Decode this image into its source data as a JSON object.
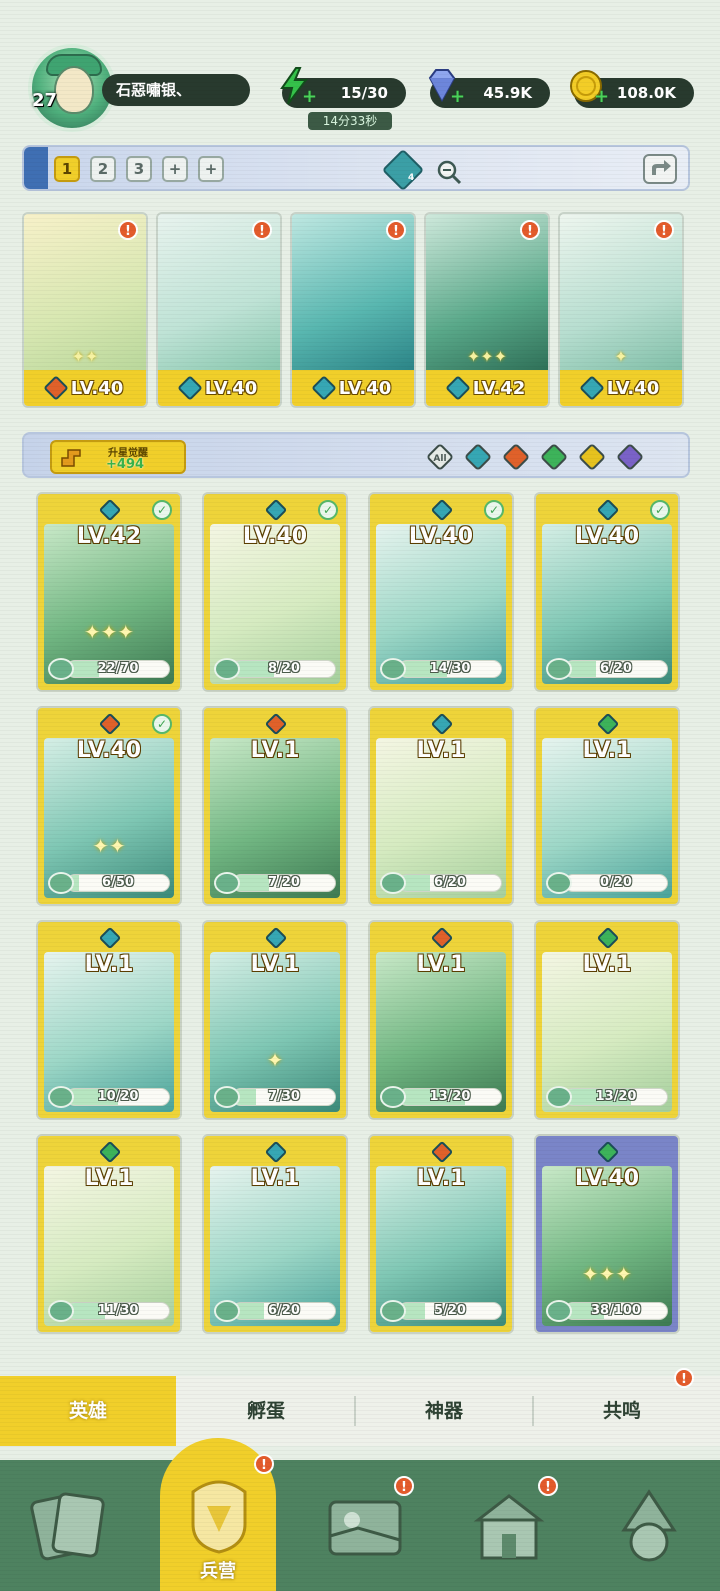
{
  "player": {
    "level": "27",
    "name": "石惡嘯银、"
  },
  "resources": {
    "energy": "15/30",
    "energy_timer": "14分33秒",
    "gems": "45.9K",
    "gold": "108.0K"
  },
  "team": {
    "tabs": [
      "1",
      "2",
      "3",
      "+",
      "+"
    ],
    "active_tab": 0,
    "gem_count": "4"
  },
  "formation": [
    {
      "level": "LV.40",
      "element": "fire",
      "stars": 2,
      "alert": "!"
    },
    {
      "level": "LV.40",
      "element": "water",
      "stars": 0,
      "alert": "!"
    },
    {
      "level": "LV.40",
      "element": "water",
      "stars": 0,
      "alert": "!"
    },
    {
      "level": "LV.42",
      "element": "water",
      "stars": 3,
      "alert": "!"
    },
    {
      "level": "LV.40",
      "element": "water",
      "stars": 1,
      "alert": "!"
    }
  ],
  "upgrade": {
    "label": "升星觉醒",
    "value": "+494"
  },
  "element_filters": [
    "All",
    "water",
    "fire",
    "wood",
    "light",
    "dark"
  ],
  "heroes": [
    {
      "level": "LV.42",
      "progress": "22/70",
      "fill": 0.31,
      "checked": true,
      "stars": 3,
      "frame": "yellow",
      "element": "water"
    },
    {
      "level": "LV.40",
      "progress": "8/20",
      "fill": 0.4,
      "checked": true,
      "stars": 0,
      "frame": "yellow",
      "element": "water"
    },
    {
      "level": "LV.40",
      "progress": "14/30",
      "fill": 0.47,
      "checked": true,
      "stars": 0,
      "frame": "yellow",
      "element": "water"
    },
    {
      "level": "LV.40",
      "progress": "6/20",
      "fill": 0.3,
      "checked": true,
      "stars": 0,
      "frame": "yellow",
      "element": "water"
    },
    {
      "level": "LV.40",
      "progress": "6/50",
      "fill": 0.12,
      "checked": true,
      "stars": 2,
      "frame": "yellow",
      "element": "fire"
    },
    {
      "level": "LV.1",
      "progress": "7/20",
      "fill": 0.35,
      "checked": false,
      "stars": 0,
      "frame": "yellow",
      "element": "fire"
    },
    {
      "level": "LV.1",
      "progress": "6/20",
      "fill": 0.3,
      "checked": false,
      "stars": 0,
      "frame": "yellow",
      "element": "water"
    },
    {
      "level": "LV.1",
      "progress": "0/20",
      "fill": 0.0,
      "checked": false,
      "stars": 0,
      "frame": "yellow",
      "element": "wood"
    },
    {
      "level": "LV.1",
      "progress": "10/20",
      "fill": 0.5,
      "checked": false,
      "stars": 0,
      "frame": "yellow",
      "element": "water"
    },
    {
      "level": "LV.1",
      "progress": "7/30",
      "fill": 0.23,
      "checked": false,
      "stars": 1,
      "frame": "yellow",
      "element": "water"
    },
    {
      "level": "LV.1",
      "progress": "13/20",
      "fill": 0.65,
      "checked": false,
      "stars": 0,
      "frame": "yellow",
      "element": "fire"
    },
    {
      "level": "LV.1",
      "progress": "13/20",
      "fill": 0.65,
      "checked": false,
      "stars": 0,
      "frame": "yellow",
      "element": "wood"
    },
    {
      "level": "LV.1",
      "progress": "11/30",
      "fill": 0.37,
      "checked": false,
      "stars": 0,
      "frame": "yellow",
      "element": "wood"
    },
    {
      "level": "LV.1",
      "progress": "6/20",
      "fill": 0.3,
      "checked": false,
      "stars": 0,
      "frame": "yellow",
      "element": "water"
    },
    {
      "level": "LV.1",
      "progress": "5/20",
      "fill": 0.25,
      "checked": false,
      "stars": 0,
      "frame": "yellow",
      "element": "fire"
    },
    {
      "level": "LV.40",
      "progress": "38/100",
      "fill": 0.38,
      "checked": false,
      "stars": 3,
      "frame": "purple",
      "element": "wood"
    }
  ],
  "subtabs": [
    {
      "label": "英雄",
      "active": true,
      "alert": ""
    },
    {
      "label": "孵蛋",
      "active": false,
      "alert": ""
    },
    {
      "label": "神器",
      "active": false,
      "alert": ""
    },
    {
      "label": "共鸣",
      "active": false,
      "alert": "!"
    }
  ],
  "nav": [
    {
      "label": "",
      "icon": "cards-icon",
      "active": false,
      "alert": ""
    },
    {
      "label": "兵营",
      "icon": "barracks-icon",
      "active": true,
      "alert": "!"
    },
    {
      "label": "",
      "icon": "map-icon",
      "active": false,
      "alert": "!"
    },
    {
      "label": "",
      "icon": "shop-icon",
      "active": false,
      "alert": "!"
    },
    {
      "label": "",
      "icon": "character-icon",
      "active": false,
      "alert": ""
    }
  ],
  "colors": {
    "accent_yellow": "#f1cf2a",
    "water": "#36a7b4",
    "fire": "#e0612a",
    "wood": "#3db35a",
    "light": "#e6c21e",
    "dark": "#7a62c7"
  }
}
